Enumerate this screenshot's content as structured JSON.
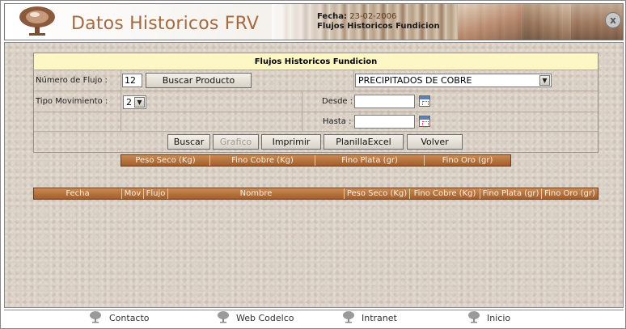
{
  "header": {
    "title": "Datos Historicos FRV",
    "fecha_label": "Fecha:",
    "fecha_value": "23-02-2006",
    "subtitle": "Flujos Historicos Fundicion",
    "close_label": "x"
  },
  "form": {
    "panel_title": "Flujos Historicos Fundicion",
    "numero_flujo_label": "Número de Flujo :",
    "numero_flujo_value": "12",
    "buscar_producto_label": "Buscar Producto",
    "producto_selected": "PRECIPITADOS DE COBRE",
    "tipo_movimiento_label": "Tipo Movimiento :",
    "tipo_movimiento_value": "2",
    "desde_label": "Desde :",
    "desde_value": "",
    "hasta_label": "Hasta :",
    "hasta_value": "",
    "buttons": {
      "buscar": "Buscar",
      "grafico": "Grafico",
      "imprimir": "Imprimir",
      "planilla": "PlanillaExcel",
      "volver": "Volver"
    }
  },
  "summary_table": {
    "columns": [
      "Peso Seco (Kg)",
      "Fino Cobre (Kg)",
      "Fino Plata (gr)",
      "Fino Oro (gr)"
    ]
  },
  "detail_table": {
    "columns": [
      "Fecha",
      "Mov",
      "Flujo",
      "Nombre",
      "Peso Seco (Kg)",
      "Fino Cobre (Kg)",
      "Fino Plata (gr)",
      "Fino Oro (gr)"
    ]
  },
  "footer": {
    "links": [
      "Contacto",
      "Web Codelco",
      "Intranet",
      "Inicio"
    ]
  },
  "colors": {
    "accent": "#a46b43",
    "header_bar": "#b06a35",
    "panel_title_bg": "#fdf7c6"
  }
}
